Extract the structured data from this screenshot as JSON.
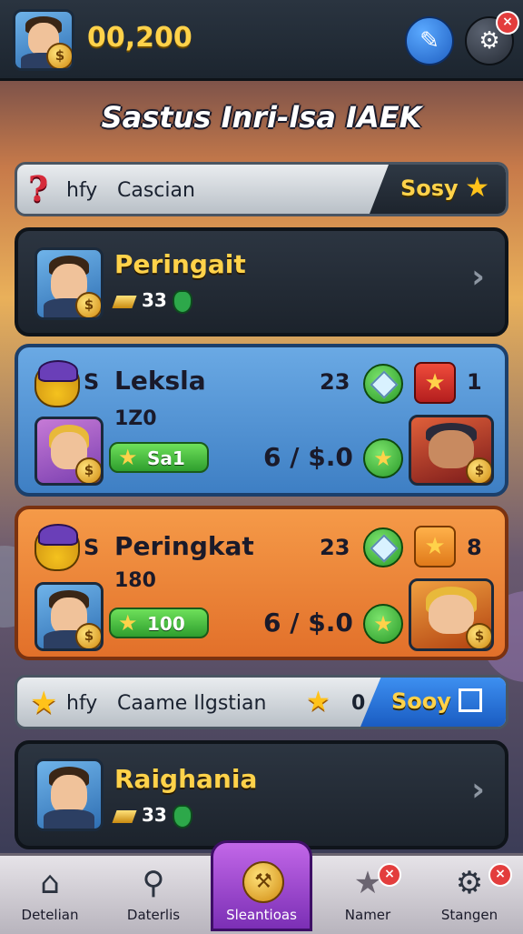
{
  "header": {
    "coins": "00,200",
    "title": "Sastus Inri-lsa IAEK"
  },
  "banner_top": {
    "left_a": "hfy",
    "left_b": "Cascian",
    "right_label": "Sosy"
  },
  "cards": {
    "first": {
      "name": "Peringait",
      "count": "33"
    },
    "blue": {
      "rank_letter": "S",
      "name": "Leksla",
      "score": "23",
      "badge_count": "1",
      "sub_value": "1Z0",
      "pill_value": "Sa1",
      "price": "6 / $.0"
    },
    "orange": {
      "rank_letter": "S",
      "name": "Peringkat",
      "score": "23",
      "badge_count": "8",
      "sub_value": "180",
      "pill_value": "100",
      "price": "6 / $.0"
    },
    "last": {
      "name": "Raighania",
      "count": "33"
    }
  },
  "banner_bottom": {
    "left_a": "hfy",
    "left_b": "Caame Ilgstian",
    "middle_value": "0",
    "right_label": "Sooy"
  },
  "nav": [
    {
      "label": "Detelian",
      "icon": "home-icon"
    },
    {
      "label": "Daterlis",
      "icon": "search-icon"
    },
    {
      "label": "Sleantioas",
      "icon": "hammer-icon"
    },
    {
      "label": "Namer",
      "icon": "star-icon"
    },
    {
      "label": "Stangen",
      "icon": "gear-icon"
    }
  ],
  "colors": {
    "gold": "#ffd24a",
    "blue_card": "#3e7fc4",
    "orange_card": "#e2702a",
    "active_nav": "#7b2fb5",
    "alert_red": "#e33d3d"
  }
}
